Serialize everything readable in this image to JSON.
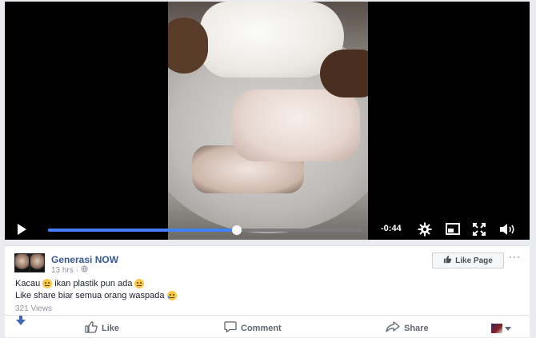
{
  "video": {
    "time_remaining": "-0:44",
    "progress_fraction": 0.6
  },
  "post": {
    "page_name": "Generasi NOW",
    "timestamp": "13 hrs",
    "separator": "·",
    "like_page_label": "Like Page",
    "more_label": "···",
    "caption_line1_part1": "Kacau",
    "caption_line1_part2": "ikan plastik pun ada",
    "caption_line2": "Like share biar semua orang waspada",
    "views": "321 Views"
  },
  "actions": {
    "like_label": "Like",
    "comment_label": "Comment",
    "share_label": "Share"
  },
  "colors": {
    "link_blue": "#365899",
    "progress_blue": "#4080ff",
    "muted": "#90949c"
  },
  "icons": [
    "play-icon",
    "settings-icon",
    "mini-player-icon",
    "fullscreen-icon",
    "volume-icon",
    "globe-icon",
    "thumbs-up-icon",
    "comment-icon",
    "share-icon",
    "arrow-down-icon",
    "caret-down-icon"
  ]
}
